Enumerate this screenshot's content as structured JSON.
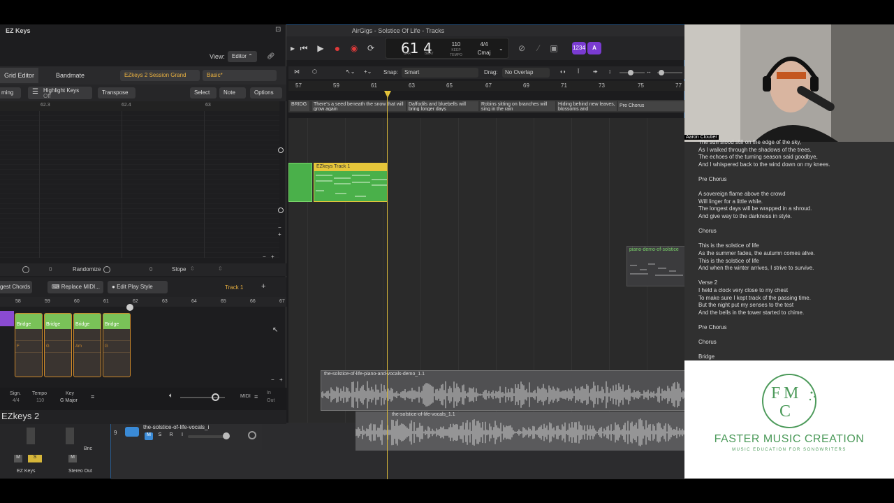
{
  "window_title": "AirGigs - Solstice Of Life - Tracks",
  "transport": {
    "bar": "61",
    "beat": "4",
    "bar_caption": "BAR",
    "beat_caption": "BEAT",
    "tempo": "110",
    "tempo_mode": "KEEP",
    "tempo_caption": "TEMPO",
    "time_sig": "4/4",
    "key": "Cmaj",
    "count_in": "1234",
    "tuner": "A"
  },
  "arrange": {
    "snap_label": "Snap:",
    "snap_value": "Smart",
    "drag_label": "Drag:",
    "drag_value": "No Overlap",
    "ruler": [
      "57",
      "59",
      "61",
      "63",
      "65",
      "67",
      "69",
      "71",
      "73",
      "75",
      "77"
    ],
    "lyric_cells": [
      "BRIDG",
      "There's a seed beneath the snow that will grow again",
      "Daffodils and bluebells will bring longer days",
      "Robins sitting on branches will sing in the rain",
      "Hiding behind new leaves, blossoms and",
      "Pre Chorus"
    ],
    "region_ezkeys": "EZkeys Track 1",
    "region_piano_demo": "piano-demo-of-solstice",
    "region_audio_1": "the-solstice-of-life-piano-and-vocals-demo_1.1",
    "region_audio_2": "the-solstice-of-life-vocals_1.1",
    "track_number": "9",
    "track_name": "the-solstice-of-life-vocals_i",
    "track_buttons": [
      "M",
      "S",
      "R",
      "I"
    ]
  },
  "mixer": {
    "channel1_name": "EZ Keys",
    "channel2_name": "Stereo Out",
    "bnc_label": "Bnc",
    "m_label": "M",
    "s_label": "S"
  },
  "ezkeys": {
    "window_title": "EZ Keys",
    "view_label": "View:",
    "view_value": "Editor",
    "tab_grid": "Grid Editor",
    "tab_bandmate": "Bandmate",
    "preset": "EZkeys 2 Session Grand",
    "preset2": "Basic*",
    "humanizing": "ming",
    "highlight": "Highlight Keys",
    "highlight_state": "Off",
    "transpose": "Transpose",
    "select": "Select",
    "note": "Note",
    "options": "Options",
    "ruler": [
      "62.3",
      "62.4",
      "63"
    ],
    "randomize": "Randomize",
    "slope": "Slope",
    "zero1": "0",
    "zero2": "0",
    "suggest_chords": "gest Chords",
    "replace_midi": "Replace MIDI...",
    "edit_play_style": "Edit Play Style",
    "track_label": "Track 1",
    "plus": "+",
    "bars": [
      "58",
      "59",
      "60",
      "61",
      "62",
      "63",
      "64",
      "65",
      "66",
      "67"
    ],
    "chords": [
      {
        "section": "Bridge",
        "chord": "F"
      },
      {
        "section": "Bridge",
        "chord": "G"
      },
      {
        "section": "Bridge",
        "chord": "Am"
      },
      {
        "section": "Bridge",
        "chord": "G"
      }
    ],
    "sign_label": "Sign.",
    "sign_value": "4/4",
    "tempo_label": "Tempo",
    "tempo_value": "110",
    "key_label": "Key",
    "key_value": "G Major",
    "midi_label": "MIDI",
    "in_label": "In",
    "out_label": "Out",
    "footer_title": "EZkeys 2"
  },
  "video": {
    "name_tag": "Aaron Cloutier"
  },
  "lyrics_panel": {
    "lines": [
      "The sun stood still on the edge of the sky,",
      "As I walked through the shadows of the trees.",
      "The echoes of the turning season said goodbye,",
      "And I whispered back to the wind down on my knees.",
      "",
      "Pre Chorus",
      "",
      "A sovereign flame above the crowd",
      "Will linger for a little while.",
      "The longest days will be wrapped in a shroud.",
      "And give way to the darkness in style.",
      "",
      "Chorus",
      "",
      "This is the solstice of life",
      "As the summer fades, the autumn comes alive.",
      "This is the solstice of life",
      "And when the winter arrives, I strive to survive.",
      "",
      "Verse 2",
      "I held a clock very close to my chest",
      "To make sure I kept track of the passing time.",
      "But the night put my senses to the test",
      "And the bells in the tower started to chime.",
      "",
      "Pre Chorus",
      "",
      "Chorus",
      "",
      "Bridge"
    ]
  },
  "brand": {
    "monogram": "FMC",
    "name": "FASTER MUSIC CREATION",
    "tagline": "MUSIC EDUCATION FOR SONGWRITERS",
    "color": "#4c9a5a"
  },
  "colors": {
    "accent_green": "#79c258",
    "region_yellow": "#e6c63a",
    "record_red": "#e03a3a",
    "purple": "#7a3bd1",
    "orange": "#d08a2a"
  }
}
